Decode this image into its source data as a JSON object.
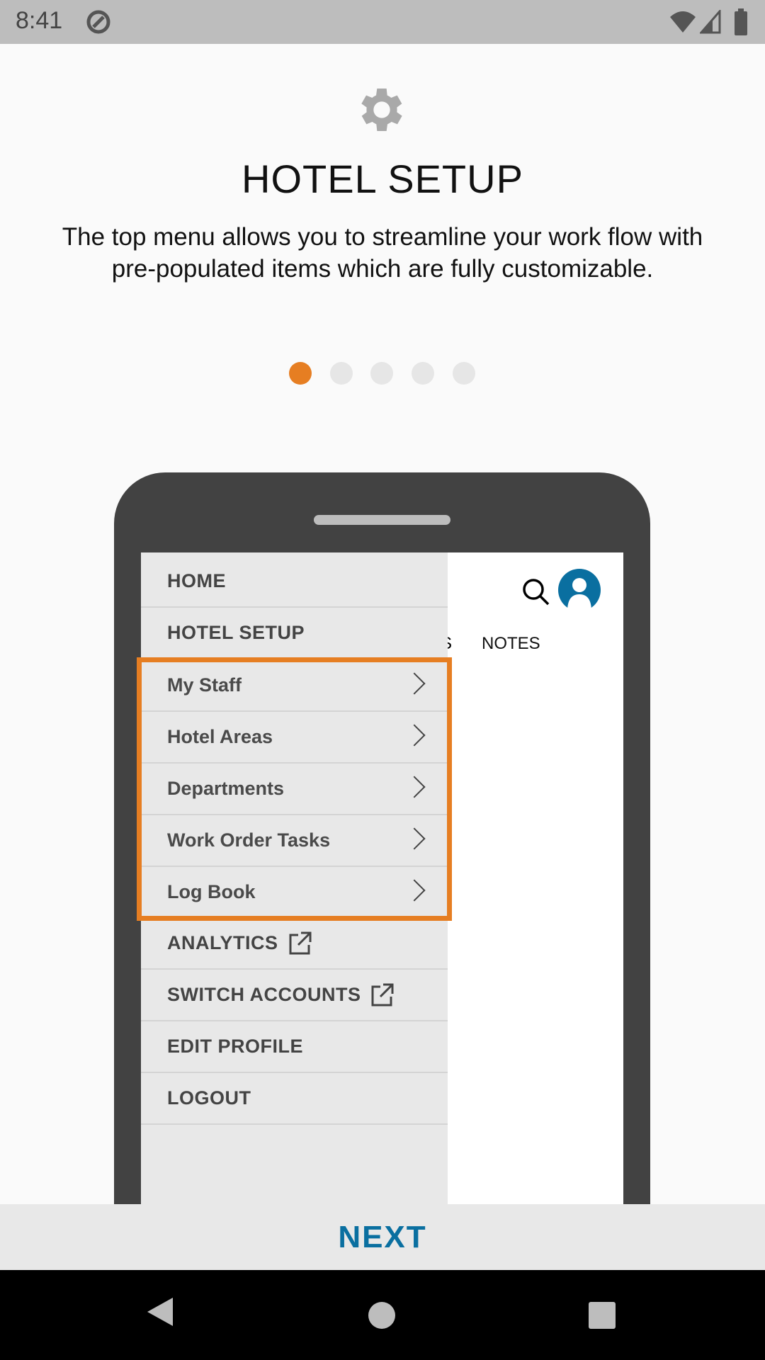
{
  "status_bar": {
    "time": "8:41"
  },
  "header": {
    "icon": "gear-icon",
    "title": "HOTEL SETUP",
    "description": "The top menu allows you to streamline your work flow with pre-populated items which are fully customizable."
  },
  "pager": {
    "count": 5,
    "active_index": 0,
    "active_color": "#e67e22"
  },
  "mockup": {
    "menu": {
      "home": "HOME",
      "hotel_setup": "HOTEL SETUP",
      "sub_items": [
        {
          "label": "My Staff"
        },
        {
          "label": "Hotel Areas"
        },
        {
          "label": "Departments"
        },
        {
          "label": "Work Order Tasks"
        },
        {
          "label": "Log Book"
        }
      ],
      "analytics": "ANALYTICS",
      "switch_accounts": "SWITCH ACCOUNTS",
      "edit_profile": "EDIT PROFILE",
      "logout": "LOGOUT"
    },
    "tab_partial": "S",
    "tab_notes": "NOTES",
    "highlight_color": "#e67e22"
  },
  "footer": {
    "next_label": "NEXT",
    "accent": "#0a6fa0"
  }
}
